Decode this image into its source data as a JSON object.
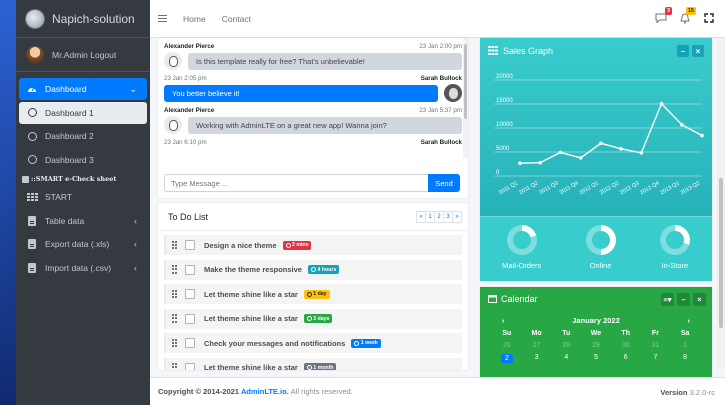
{
  "brand": {
    "title": "Napich-solution"
  },
  "user": {
    "label": "Mr.Admin Logout"
  },
  "sidebar": {
    "dashboard": "Dashboard",
    "sub": [
      "Dashboard 1",
      "Dashboard 2",
      "Dashboard 3"
    ],
    "header": "::SMART e-Check sheet",
    "items": [
      "START",
      "Table data",
      "Export data (.xls)",
      "Import data (.csv)"
    ]
  },
  "topnav": {
    "home": "Home",
    "contact": "Contact",
    "messages_badge": "3",
    "notifications_badge": "15"
  },
  "chat": {
    "messages": [
      {
        "name": "Alexander Pierce",
        "time": "23 Jan 2:00 pm",
        "text": "Is this template really for free? That's unbelievable!"
      },
      {
        "name": "Sarah Bullock",
        "time": "23 Jan 2:05 pm",
        "text": "You better believe it!"
      },
      {
        "name": "Alexander Pierce",
        "time": "23 Jan 5:37 pm",
        "text": "Working with AdminLTE on a great new app! Wanna join?"
      },
      {
        "name": "Sarah Bullock",
        "time": "23 Jan 6:10 pm"
      }
    ],
    "placeholder": "Type Message ...",
    "send": "Send"
  },
  "todo": {
    "title": "To Do List",
    "pager": [
      "«",
      "1",
      "2",
      "3",
      "»"
    ],
    "items": [
      {
        "text": "Design a nice theme",
        "badge": "2 mins",
        "color": "#dc3545"
      },
      {
        "text": "Make the theme responsive",
        "badge": "4 hours",
        "color": "#17a2b8"
      },
      {
        "text": "Let theme shine like a star",
        "badge": "1 day",
        "color": "#ffc107"
      },
      {
        "text": "Let theme shine like a star",
        "badge": "3 days",
        "color": "#28a745"
      },
      {
        "text": "Check your messages and notifications",
        "badge": "1 week",
        "color": "#007bff"
      },
      {
        "text": "Let theme shine like a star",
        "badge": "1 month",
        "color": "#6c757d"
      }
    ]
  },
  "sales": {
    "title": "Sales Graph",
    "knobs": [
      "Mail-Orders",
      "Online",
      "In-Store"
    ],
    "knob_values": [
      20,
      50,
      30
    ]
  },
  "chart_data": {
    "type": "line",
    "title": "Sales Graph",
    "categories": [
      "2011 Q1",
      "2011 Q2",
      "2011 Q3",
      "2011 Q4",
      "2012 Q1",
      "2012 Q2",
      "2012 Q3",
      "2012 Q4",
      "2013 Q1",
      "2013 Q2"
    ],
    "values": [
      2666,
      2778,
      4912,
      3767,
      6810,
      5670,
      4820,
      15073,
      10687,
      8432
    ],
    "yticks": [
      "20000",
      "15000",
      "10000",
      "5000",
      "0"
    ],
    "ylim": [
      0,
      20000
    ],
    "grid": true
  },
  "calendar": {
    "title": "Calendar",
    "month": "January 2022",
    "weekdays": [
      "Su",
      "Mo",
      "Tu",
      "We",
      "Th",
      "Fr",
      "Sa"
    ],
    "prev_row": [
      "26",
      "27",
      "28",
      "29",
      "30",
      "31",
      "1"
    ],
    "row2": [
      "2",
      "3",
      "4",
      "5",
      "6",
      "7",
      "8"
    ]
  },
  "footer": {
    "copy": "Copyright © 2014-2021",
    "link": "AdminLTE.io.",
    "rights": "All rights reserved.",
    "version_label": "Version",
    "version": "3.2.0-rc"
  }
}
